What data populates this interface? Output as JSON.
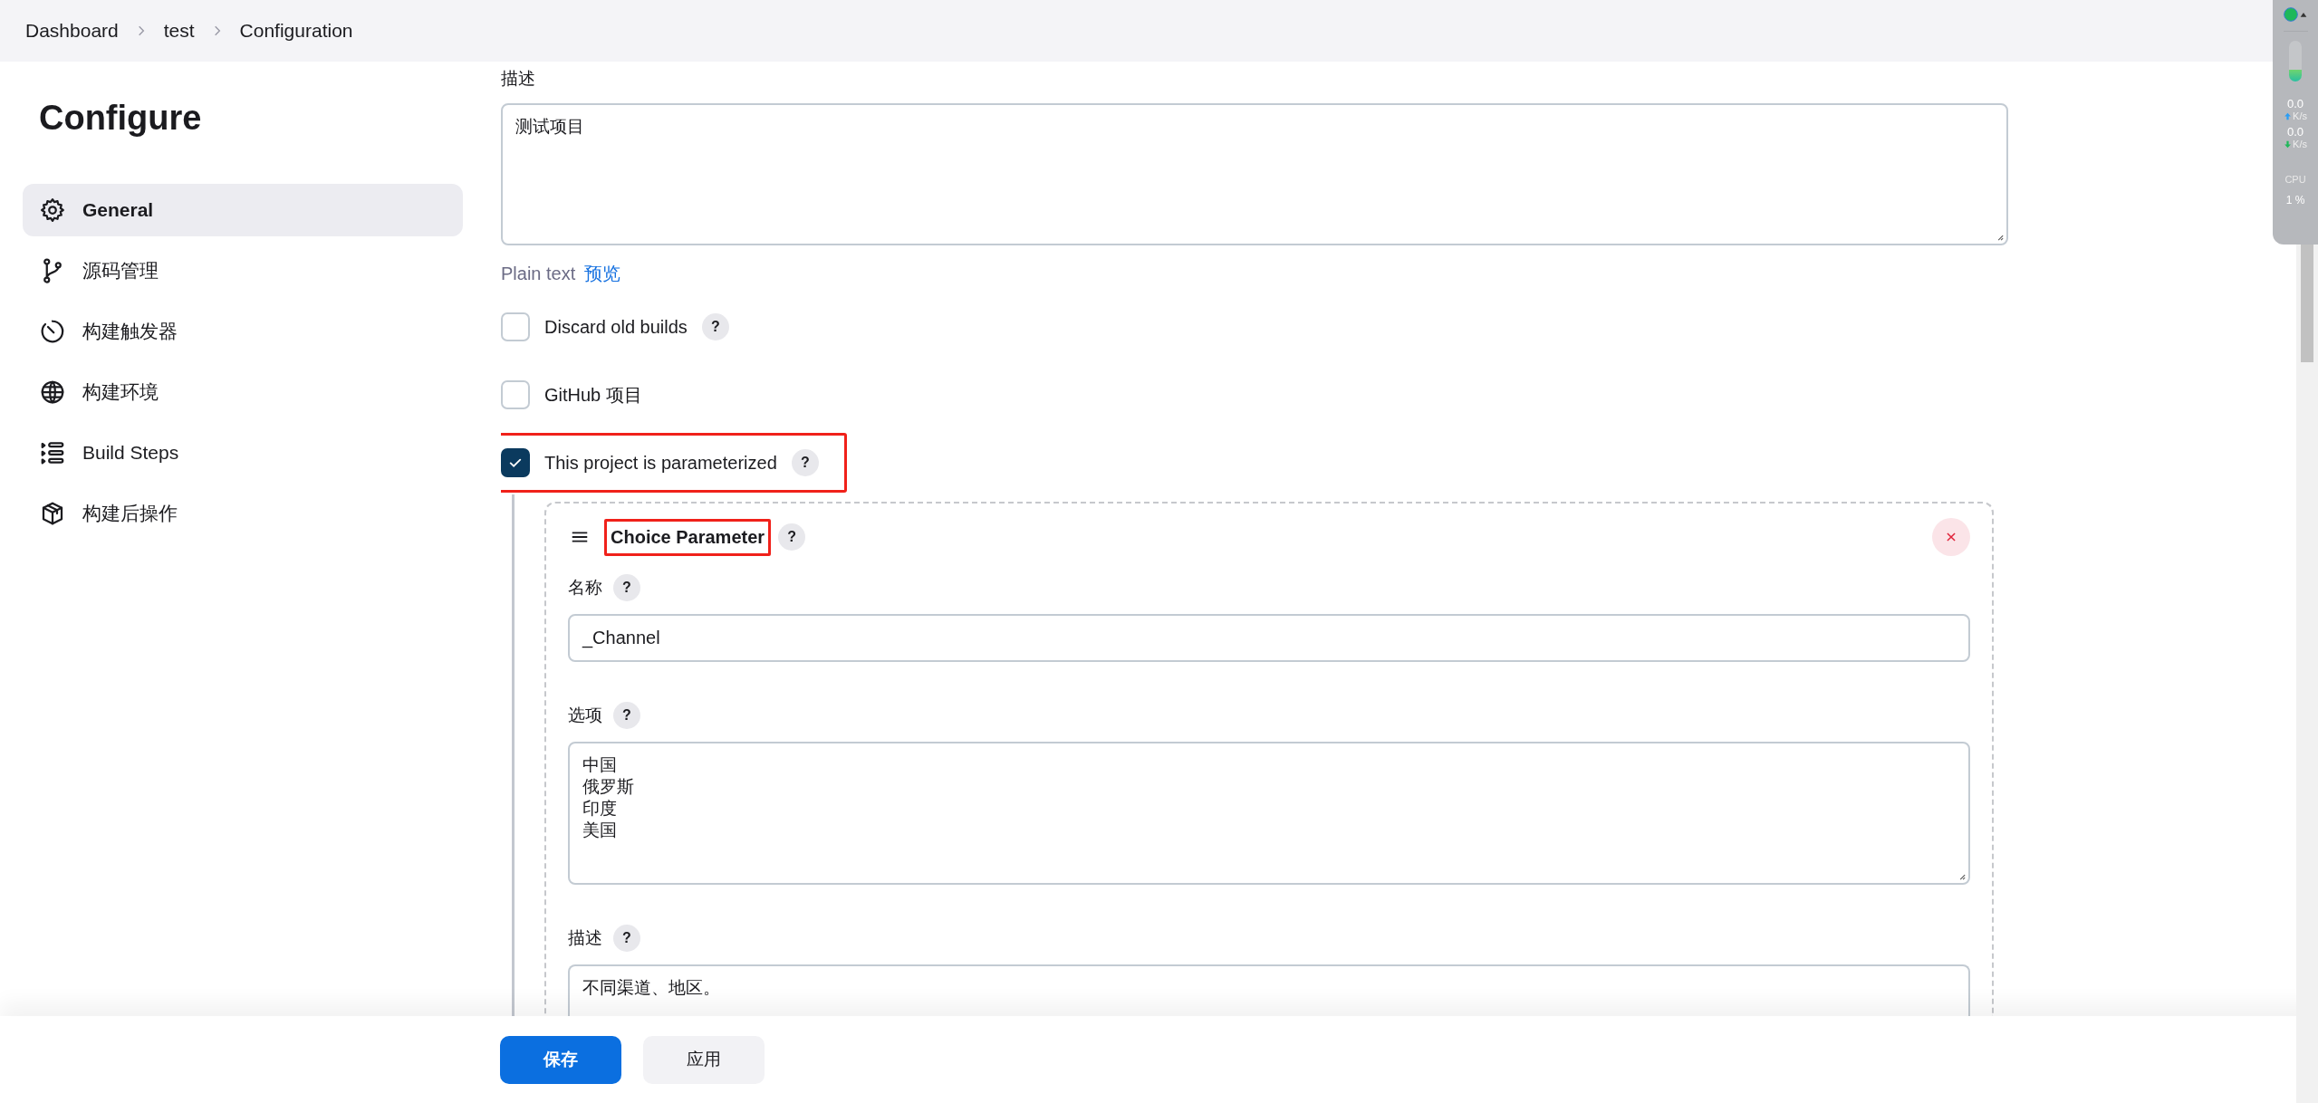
{
  "breadcrumbs": [
    {
      "label": "Dashboard"
    },
    {
      "label": "test"
    },
    {
      "label": "Configuration"
    }
  ],
  "sidebar": {
    "title": "Configure",
    "items": [
      {
        "label": "General",
        "selected": true
      },
      {
        "label": "源码管理",
        "selected": false
      },
      {
        "label": "构建触发器",
        "selected": false
      },
      {
        "label": "构建环境",
        "selected": false
      },
      {
        "label": "Build Steps",
        "selected": false
      },
      {
        "label": "构建后操作",
        "selected": false
      }
    ]
  },
  "description": {
    "label": "描述",
    "value": "测试项目"
  },
  "format": {
    "label": "Plain text",
    "link": "预览"
  },
  "options": [
    {
      "label": "Discard old builds",
      "help": "?",
      "checked": false,
      "highlighted": false
    },
    {
      "label": "GitHub 项目",
      "checked": false,
      "highlighted": false
    },
    {
      "label": "This project is parameterized",
      "help": "?",
      "checked": true,
      "highlighted": true
    }
  ],
  "parameter": {
    "title": "Choice Parameter",
    "title_highlighted": true,
    "help": "?",
    "fields": [
      {
        "label": "名称",
        "help": "?",
        "kind": "input",
        "value": "_Channel"
      },
      {
        "label": "选项",
        "help": "?",
        "kind": "textarea",
        "lines": [
          "中国",
          "俄罗斯",
          "印度",
          "美国"
        ]
      },
      {
        "label": "描述",
        "help": "?",
        "kind": "textarea",
        "lines": [
          "不同渠道、地区。"
        ]
      }
    ]
  },
  "actions": [
    {
      "label": "保存",
      "kind": "primary"
    },
    {
      "label": "应用",
      "kind": "secondary"
    }
  ],
  "monitor": {
    "level": 0.3,
    "upload": "0.0",
    "upload_unit": "K/s",
    "download": "0.0",
    "download_unit": "K/s",
    "cpu_label": "CPU",
    "cpu": "1 %"
  }
}
